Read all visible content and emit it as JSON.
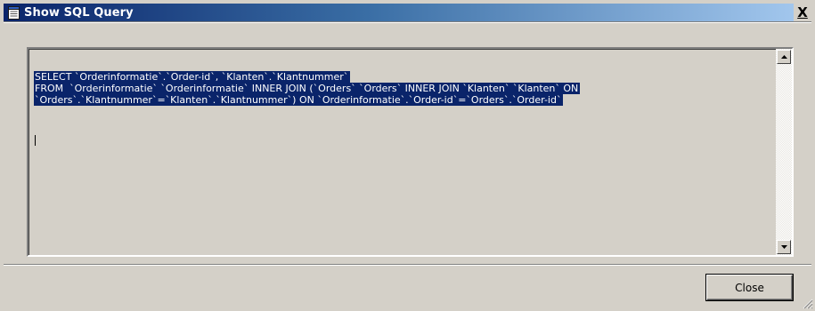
{
  "window": {
    "title": "Show SQL Query",
    "icon": "notepad-icon",
    "close_glyph": "X"
  },
  "editor": {
    "sql_lines": [
      "SELECT `Orderinformatie`.`Order-id`, `Klanten`.`Klantnummer`",
      "FROM  `Orderinformatie` `Orderinformatie` INNER JOIN (`Orders` `Orders` INNER JOIN `Klanten` `Klanten` ON",
      "`Orders`.`Klantnummer`=`Klanten`.`Klantnummer`) ON `Orderinformatie`.`Order-id`=`Orders`.`Order-id`"
    ],
    "selection_color": "#0a246a"
  },
  "buttons": {
    "close_label": "Close"
  },
  "colors": {
    "title_gradient_start": "#0a246a",
    "title_gradient_end": "#a6caf0",
    "face": "#d4d0c8"
  }
}
